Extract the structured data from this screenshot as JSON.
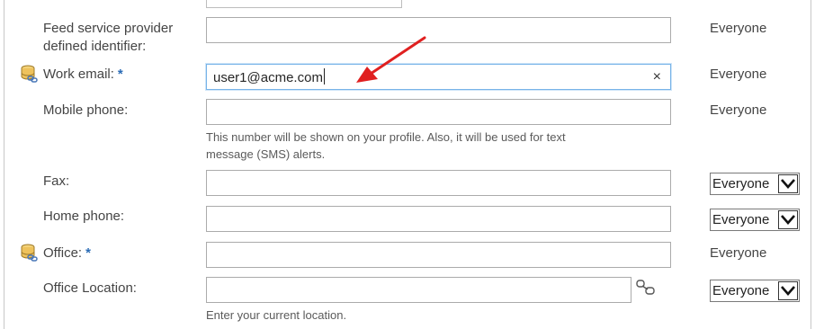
{
  "fields": [
    {
      "label": "Feed service provider",
      "label_line2": "defined identifier:",
      "value": "",
      "privacy": "Everyone"
    },
    {
      "label": "Work email:",
      "required": "*",
      "value": "user1@acme.com",
      "privacy": "Everyone",
      "clear_icon": "×"
    },
    {
      "label": "Mobile phone:",
      "value": "",
      "privacy": "Everyone",
      "help_line1": "This number will be shown on your profile. Also, it will be used for text",
      "help_line2": "message (SMS) alerts."
    },
    {
      "label": "Fax:",
      "value": "",
      "privacy": "Everyone"
    },
    {
      "label": "Home phone:",
      "value": "",
      "privacy": "Everyone"
    },
    {
      "label": "Office:",
      "required": "*",
      "value": "",
      "privacy": "Everyone"
    },
    {
      "label": "Office Location:",
      "value": "",
      "privacy": "Everyone",
      "help_line1": "Enter your current location."
    }
  ],
  "icons": {
    "database": "database-link-icon",
    "clear": "close-icon",
    "browse_location": "address-book-icon",
    "dropdown": "chevron-down-icon",
    "annotation": "red-arrow"
  },
  "colors": {
    "required_marker": "#2a6bb5",
    "focus_border": "#77b3e8",
    "annotation_arrow": "#e02020"
  }
}
